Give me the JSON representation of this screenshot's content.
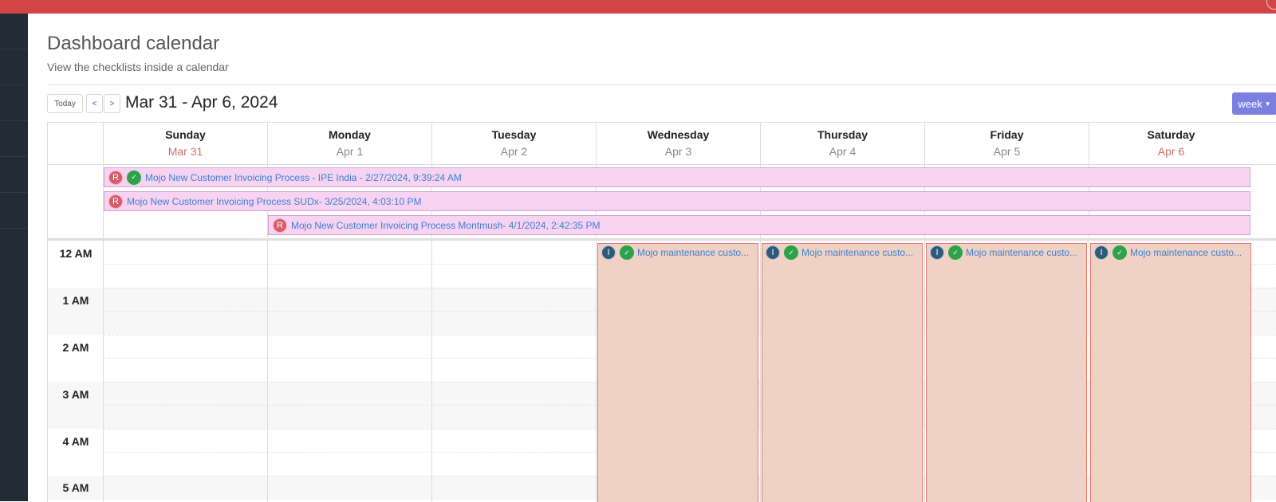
{
  "header": {
    "title": "Dashboard calendar",
    "subtitle": "View the checklists inside a calendar"
  },
  "toolbar": {
    "today_label": "Today",
    "prev_label": "<",
    "next_label": ">",
    "range_title": "Mar 31 - Apr 6, 2024",
    "view_label": "week"
  },
  "days": [
    {
      "name": "Sunday",
      "date": "Mar 31"
    },
    {
      "name": "Monday",
      "date": "Apr 1"
    },
    {
      "name": "Tuesday",
      "date": "Apr 2"
    },
    {
      "name": "Wednesday",
      "date": "Apr 3"
    },
    {
      "name": "Thursday",
      "date": "Apr 4"
    },
    {
      "name": "Friday",
      "date": "Apr 5"
    },
    {
      "name": "Saturday",
      "date": "Apr 6"
    }
  ],
  "allday_events": [
    {
      "badge": "R",
      "status_icon": "check-icon",
      "title": "Mojo New Customer Invoicing Process - IPE India - 2/27/2024, 9:39:24 AM"
    },
    {
      "badge": "R",
      "title": "Mojo New Customer Invoicing Process SUDx- 3/25/2024, 4:03:10 PM"
    },
    {
      "badge": "R",
      "title": "Mojo New Customer Invoicing Process Montmush- 4/1/2024, 2:42:35 PM"
    }
  ],
  "hours": [
    "12 AM",
    "1 AM",
    "2 AM",
    "3 AM",
    "4 AM",
    "5 AM"
  ],
  "timed_events": [
    {
      "badge": "I",
      "status_icon": "check-icon",
      "title": "Mojo maintenance custo..."
    },
    {
      "badge": "I",
      "status_icon": "check-icon",
      "title": "Mojo maintenance custo..."
    },
    {
      "badge": "I",
      "status_icon": "check-icon",
      "title": "Mojo maintenance custo..."
    },
    {
      "badge": "I",
      "status_icon": "check-icon",
      "title": "Mojo maintenance custo..."
    }
  ],
  "colors": {
    "topbar": "#d14447",
    "sidebar": "#222b36",
    "accent": "#7b7fe0",
    "allday_event_bg": "#f5d3f1",
    "timed_event_bg": "#efd2c4",
    "weekend_date": "#c97070"
  }
}
